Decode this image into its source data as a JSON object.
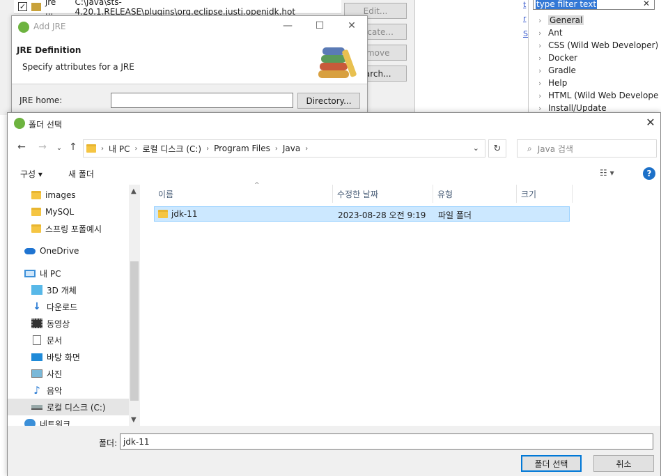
{
  "background": {
    "jre_row": {
      "name": "jre ...",
      "path": "C:\\Java\\sts-4.20.1.RELEASE\\plugins\\org.eclipse.justj.openjdk.hot"
    },
    "side_buttons": [
      "Edit...",
      "plicate...",
      "emove",
      "earch..."
    ],
    "filter_text": "type filter text",
    "tree_items": [
      "General",
      "Ant",
      "CSS (Wild Web Developer)",
      "Docker",
      "Gradle",
      "Help",
      "HTML (Wild Web Develope",
      "Install/Update"
    ]
  },
  "add_jre": {
    "title": "Add JRE",
    "header": "JRE Definition",
    "subtitle": "Specify attributes for a JRE",
    "jre_home_label": "JRE home:",
    "jre_home_value": "",
    "directory_button": "Directory..."
  },
  "folder_dialog": {
    "title": "폴더 선택",
    "breadcrumb": [
      "내 PC",
      "로컬 디스크 (C:)",
      "Program Files",
      "Java"
    ],
    "search_placeholder": "Java 검색",
    "organize": "구성 ▾",
    "new_folder": "새 폴더",
    "nav_items": [
      {
        "label": "images",
        "icon": "folder-icon"
      },
      {
        "label": "MySQL",
        "icon": "folder-icon"
      },
      {
        "label": "스프링 포폴예시",
        "icon": "folder-icon"
      },
      {
        "label": "OneDrive",
        "icon": "cloud-icon"
      },
      {
        "label": "내 PC",
        "icon": "computer-icon"
      },
      {
        "label": "3D 개체",
        "icon": "cube-icon"
      },
      {
        "label": "다운로드",
        "icon": "download-icon"
      },
      {
        "label": "동영상",
        "icon": "video-icon"
      },
      {
        "label": "문서",
        "icon": "document-icon"
      },
      {
        "label": "바탕 화면",
        "icon": "desktop-icon"
      },
      {
        "label": "사진",
        "icon": "picture-icon"
      },
      {
        "label": "음악",
        "icon": "music-icon"
      },
      {
        "label": "로컬 디스크 (C:)",
        "icon": "drive-icon"
      },
      {
        "label": "네트워크",
        "icon": "network-icon"
      }
    ],
    "columns": [
      "이름",
      "수정한 날짜",
      "유형",
      "크기"
    ],
    "rows": [
      {
        "name": "jdk-11",
        "modified": "2023-08-28 오전 9:19",
        "type": "파일 폴더",
        "size": ""
      }
    ],
    "folder_label": "폴더:",
    "folder_value": "jdk-11",
    "select_button": "폴더 선택",
    "cancel_button": "취소"
  }
}
